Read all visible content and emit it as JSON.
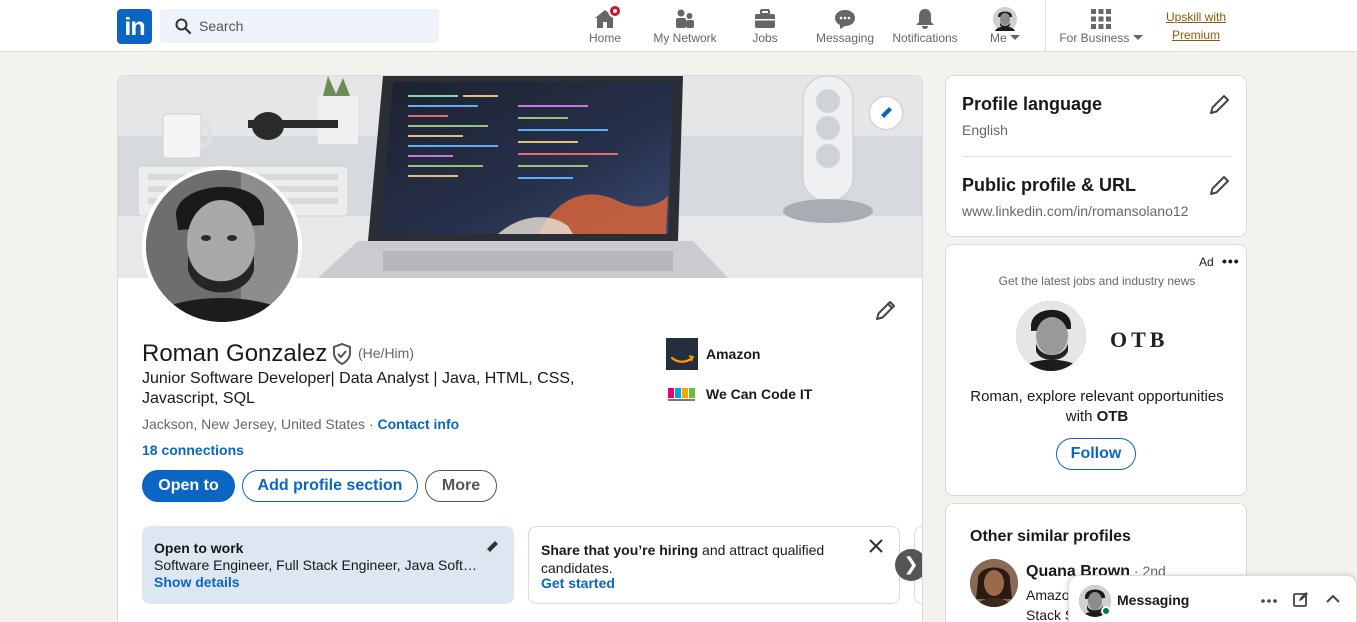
{
  "nav": {
    "logo": "in",
    "search_placeholder": "Search",
    "items": [
      {
        "label": "Home"
      },
      {
        "label": "My Network"
      },
      {
        "label": "Jobs"
      },
      {
        "label": "Messaging"
      },
      {
        "label": "Notifications"
      },
      {
        "label": "Me"
      },
      {
        "label": "For Business"
      }
    ],
    "premium_line1": "Upskill with",
    "premium_line2": "Premium"
  },
  "profile": {
    "name": "Roman Gonzalez",
    "pronouns": "(He/Him)",
    "headline": "Junior Software Developer| Data Analyst | Java, HTML, CSS, Javascript, SQL",
    "location": "Jackson, New Jersey, United States",
    "location_sep": " · ",
    "contact_info": "Contact info",
    "connections": "18 connections",
    "buttons": {
      "open_to": "Open to",
      "add_section": "Add profile section",
      "more": "More"
    },
    "companies": [
      {
        "name": "Amazon"
      },
      {
        "name": "We Can Code IT"
      }
    ],
    "open_to_work": {
      "title": "Open to work",
      "desc": "Software Engineer, Full Stack Engineer, Java Software Developer",
      "link": "Show details"
    },
    "hiring": {
      "bold": "Share that you’re hiring",
      "rest": " and attract qualified candidates.",
      "link": "Get started"
    }
  },
  "right": {
    "profile_language": {
      "title": "Profile language",
      "value": "English"
    },
    "public_profile": {
      "title": "Public profile & URL",
      "value": "www.linkedin.com/in/romansolano12"
    },
    "ad": {
      "label": "Ad",
      "dots": "•••",
      "tagline": "Get the latest jobs and industry news",
      "brand": "OTB",
      "copy_prefix": "Roman, explore relevant opportunities with ",
      "copy_brand": "OTB",
      "follow": "Follow"
    },
    "similar": {
      "title": "Other similar profiles",
      "people": [
        {
          "name": "Quana Brown",
          "degree": " · 2nd",
          "line1": "Amazon",
          "line2": "Stack S"
        }
      ]
    }
  },
  "messaging": {
    "label": "Messaging"
  },
  "colors": {
    "brand": "#0a66c2",
    "premium": "#915907",
    "notification": "#cb112d",
    "online": "#057642"
  }
}
